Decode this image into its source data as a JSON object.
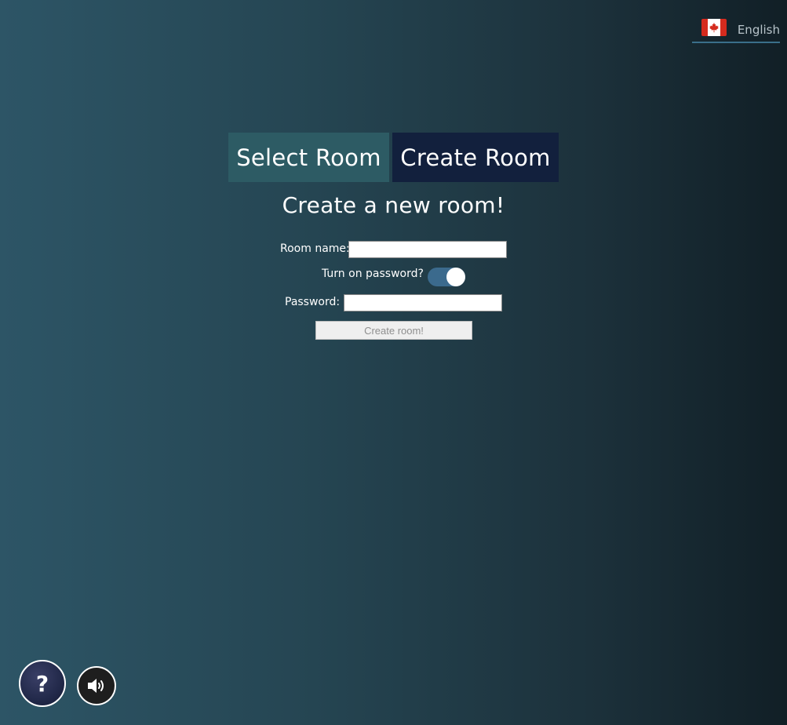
{
  "language": {
    "label": "English",
    "flag": "canada-flag-icon"
  },
  "tabs": [
    {
      "label": "Select Room",
      "active": false
    },
    {
      "label": "Create Room",
      "active": true
    }
  ],
  "form": {
    "heading": "Create a new room!",
    "room_name_label": "Room name:",
    "room_name_value": "",
    "password_toggle_label": "Turn on password?",
    "password_toggle_on": true,
    "password_label": "Password:",
    "password_value": "",
    "submit_label": "Create room!"
  },
  "footer": {
    "help_label": "?",
    "help_icon": "question-icon",
    "sound_icon": "speaker-icon"
  },
  "colors": {
    "tab_select_bg": "#2d5b64",
    "tab_create_bg": "#12203d",
    "toggle_on": "#3b6a8d"
  }
}
